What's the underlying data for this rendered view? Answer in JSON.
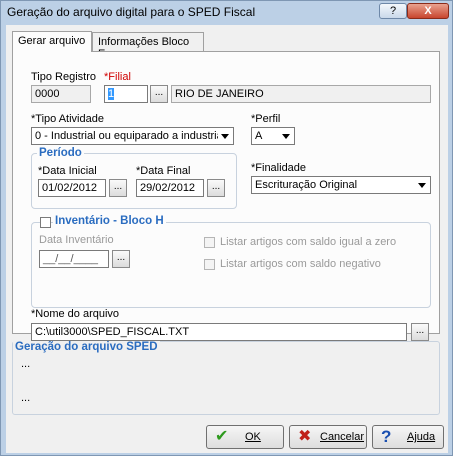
{
  "window": {
    "title": "Geração do arquivo digital para o SPED Fiscal",
    "help_glyph": "?",
    "close_glyph": "X"
  },
  "tabs": [
    {
      "label": "Gerar arquivo",
      "active": true
    },
    {
      "label": "Informações Bloco E",
      "active": false
    }
  ],
  "form": {
    "tipo_registro": {
      "label": "Tipo Registro",
      "value": "0000"
    },
    "filial": {
      "label": "*Filial",
      "value": "1",
      "button": "...",
      "description": "RIO DE JANEIRO"
    },
    "tipo_atividade": {
      "label": "*Tipo Atividade",
      "value": "0 - Industrial ou equiparado a industrial"
    },
    "perfil": {
      "label": "*Perfil",
      "value": "A"
    },
    "periodo": {
      "title": "Período",
      "data_inicial": {
        "label": "*Data Inicial",
        "value": "01/02/2012",
        "button": "..."
      },
      "data_final": {
        "label": "*Data Final",
        "value": "29/02/2012",
        "button": "..."
      }
    },
    "finalidade": {
      "label": "*Finalidade",
      "value": "Escrituração Original"
    },
    "inventario": {
      "title": "Inventário - Bloco H",
      "checked": false,
      "data_inventario": {
        "label": "Data Inventário",
        "value": "__/__/____",
        "button": "..."
      },
      "opt_saldo_zero": "Listar artigos com saldo igual a zero",
      "opt_saldo_negativo": "Listar artigos com saldo negativo"
    },
    "nome_arquivo": {
      "label": "*Nome do arquivo",
      "value": "C:\\util3000\\SPED_FISCAL.TXT",
      "button": "..."
    }
  },
  "sped": {
    "title": "Geração do arquivo SPED",
    "line1": "...",
    "line2": "..."
  },
  "buttons": {
    "ok": "OK",
    "cancel": "Cancelar",
    "help": "Ajuda"
  },
  "colors": {
    "group_title": "#2a6cc0",
    "required_red": "#d00000",
    "ok_icon": "#2e9a1e",
    "cancel_icon": "#c0201a",
    "help_icon": "#1a4fb0"
  }
}
